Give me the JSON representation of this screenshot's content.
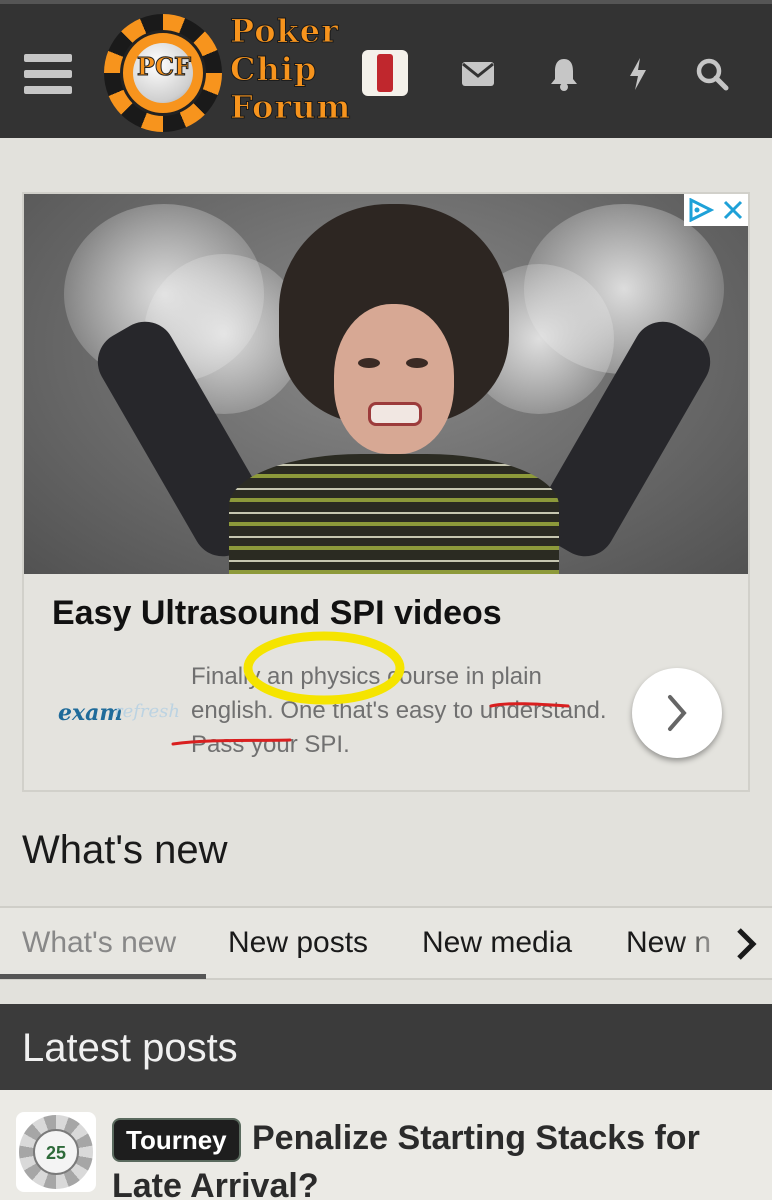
{
  "header": {
    "logo_chip_text": "PCF",
    "logo_line1": "Poker",
    "logo_line2": "Chip",
    "logo_line3": "Forum"
  },
  "ad": {
    "title": "Easy Ultrasound SPI videos",
    "description": "Finally an physics course in plain english. One that's easy to understand. Pass your SPI.",
    "brand_primary": "exam",
    "brand_secondary": "refresh"
  },
  "whats_new": {
    "title": "What's new",
    "tabs": [
      {
        "label": "What's new",
        "active": true
      },
      {
        "label": "New posts",
        "active": false
      },
      {
        "label": "New media",
        "active": false
      },
      {
        "label": "New n",
        "active": false
      }
    ]
  },
  "latest": {
    "title": "Latest posts",
    "posts": [
      {
        "label": "Tourney",
        "title": "Penalize Starting Stacks for Late Arrival?",
        "avatar_text": "25"
      }
    ]
  },
  "colors": {
    "header_bg": "#333333",
    "logo_orange": "#f7941d",
    "highlight_circle": "#f5e400",
    "annotation_red": "#d91f1f"
  }
}
